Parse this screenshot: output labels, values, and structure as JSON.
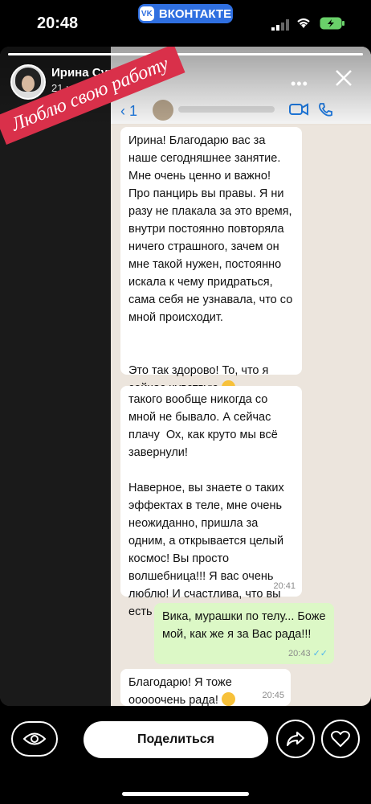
{
  "status_bar": {
    "time": "20:48",
    "app_pill": "ВКОНТАКТЕ",
    "app_logo": "VK"
  },
  "story": {
    "author": "Ирина Сумм",
    "date": "21 июн 2022",
    "progress": 1.0,
    "stamp_text": "Люблю свою работу"
  },
  "chat": {
    "back_count": "1",
    "messages": [
      {
        "from": "contact",
        "text": "Ирина! Благодарю вас за наше сегодняшнее занятие. Мне очень ценно и важно! Про панцирь вы правы. Я ни разу не плакала за это время, внутри постоянно повторяла ничего страшного, зачем он мне такой нужен, постоянно искала к чему придраться, сама себя не узнавала, что со мной происходит.\n\n\nЭто так здорово! То, что я сейчас чувствую",
        "time": ""
      },
      {
        "from": "contact",
        "text": "такого вообще никогда со мной не бывало. А сейчас плачу  Ох, как круто мы всё завернули!\n\nНаверное, вы знаете о таких эффектах в теле, мне очень неожиданно, пришла за одним, а открывается целый космос! Вы просто волшебница!!! Я вас очень люблю! И счастлива, что вы есть в моей жизни!!!",
        "time": "20:41"
      },
      {
        "from": "me",
        "text": "Вика, мурашки по телу... Боже мой, как же я за Вас рада!!!",
        "time": "20:43"
      },
      {
        "from": "contact",
        "text": "Благодарю! Я тоже ооооочень рада!",
        "time": "20:45"
      }
    ]
  },
  "actions": {
    "share_label": "Поделиться"
  },
  "colors": {
    "vk_blue": "#2f6fe0",
    "stamp_red": "#d9304a",
    "outgoing_bubble": "#dcf8c6",
    "read_ticks": "#4fb6ec"
  },
  "icons": [
    "vk-logo-icon",
    "signal-icon",
    "wifi-icon",
    "battery-icon",
    "more-icon",
    "close-icon",
    "back-chevron-icon",
    "video-call-icon",
    "phone-icon",
    "eye-icon",
    "share-arrow-icon",
    "heart-icon"
  ]
}
